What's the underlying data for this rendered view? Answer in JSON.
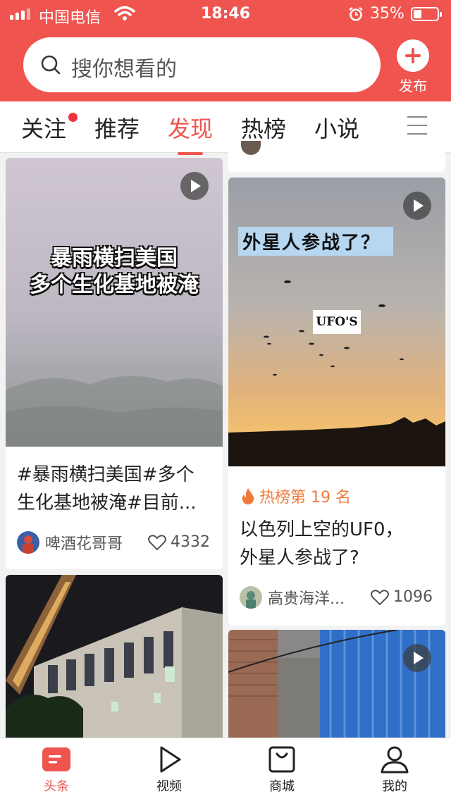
{
  "status_bar": {
    "carrier": "中国电信",
    "time": "18:46",
    "battery": "35%",
    "battery_level": 0.35
  },
  "search": {
    "placeholder": "搜你想看的"
  },
  "publish": {
    "label": "发布"
  },
  "tabs": [
    {
      "label": "关注",
      "has_dot": true
    },
    {
      "label": "推荐"
    },
    {
      "label": "发现",
      "active": true
    },
    {
      "label": "热榜"
    },
    {
      "label": "小说"
    }
  ],
  "feed": {
    "card1": {
      "overlay_lines": [
        "暴雨横扫美国",
        "多个生化基地被淹"
      ],
      "title_lines": [
        "#暴雨横扫美国#多个",
        "生化基地被淹#目前..."
      ],
      "author": "啤酒花哥哥",
      "likes": "4332"
    },
    "card2": {
      "overlay": "外星人参战了？",
      "image_label": "UFO'S",
      "hot": "热榜第 19 名",
      "title_lines": [
        "以色列上空的UF0，",
        "外星人参战了?"
      ],
      "author": "高贵海洋...",
      "likes": "1096"
    }
  },
  "bottom_nav": [
    {
      "label": "头条",
      "icon": "headline-icon",
      "active": true
    },
    {
      "label": "视频",
      "icon": "play-icon"
    },
    {
      "label": "商城",
      "icon": "shopping-bag-icon"
    },
    {
      "label": "我的",
      "icon": "profile-icon"
    }
  ],
  "colors": {
    "accent": "#f0544f",
    "hot": "#f07a3a"
  }
}
